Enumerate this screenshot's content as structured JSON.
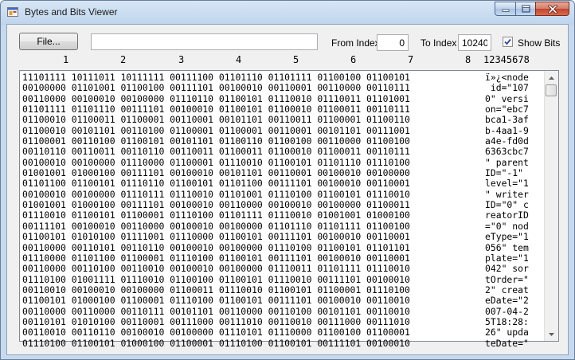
{
  "window": {
    "title": "Bytes and Bits Viewer"
  },
  "toolbar": {
    "file_label": "File...",
    "path_value": "",
    "from_label": "From Index",
    "from_value": "0",
    "to_label": "To Index",
    "to_value": "10240",
    "showbits_label": "Show Bits",
    "showbits_checked": true
  },
  "column_headers": [
    "1",
    "2",
    "3",
    "4",
    "5",
    "6",
    "7",
    "8"
  ],
  "ascii_header": "12345678",
  "rows": [
    [
      "11101111",
      "10111011",
      "10111111",
      "00111100",
      "01101110",
      "01101111",
      "01100100",
      "01100101"
    ],
    [
      "00100000",
      "01101001",
      "01100100",
      "00111101",
      "00100010",
      "00110001",
      "00110000",
      "00110111"
    ],
    [
      "00110000",
      "00100010",
      "00100000",
      "01110110",
      "01100101",
      "01110010",
      "01110011",
      "01101001"
    ],
    [
      "01101111",
      "01101110",
      "00111101",
      "00100010",
      "01100101",
      "01100010",
      "01100011",
      "00110111"
    ],
    [
      "01100010",
      "01100011",
      "01100001",
      "00110001",
      "00101101",
      "00110011",
      "01100001",
      "01100110"
    ],
    [
      "01100010",
      "00101101",
      "00110100",
      "01100001",
      "01100001",
      "00110001",
      "00101101",
      "00111001"
    ],
    [
      "01100001",
      "00110100",
      "01100101",
      "00101101",
      "01100110",
      "01100100",
      "00110000",
      "01100100"
    ],
    [
      "00110110",
      "00110011",
      "00110110",
      "00110011",
      "01100011",
      "01100010",
      "01100011",
      "00110111"
    ],
    [
      "00100010",
      "00100000",
      "01110000",
      "01100001",
      "01110010",
      "01100101",
      "01101110",
      "01110100"
    ],
    [
      "01001001",
      "01000100",
      "00111101",
      "00100010",
      "00101101",
      "00110001",
      "00100010",
      "00100000"
    ],
    [
      "01101100",
      "01100101",
      "01110110",
      "01100101",
      "01101100",
      "00111101",
      "00100010",
      "00110001"
    ],
    [
      "00100010",
      "00100000",
      "01110111",
      "01110010",
      "01101001",
      "01110100",
      "01100101",
      "01110010"
    ],
    [
      "01001001",
      "01000100",
      "00111101",
      "00100010",
      "00110000",
      "00100010",
      "00100000",
      "01100011"
    ],
    [
      "01110010",
      "01100101",
      "01100001",
      "01110100",
      "01101111",
      "01110010",
      "01001001",
      "01000100"
    ],
    [
      "00111101",
      "00100010",
      "00110000",
      "00100010",
      "00100000",
      "01101110",
      "01101111",
      "01100100"
    ],
    [
      "01100101",
      "01010100",
      "01111001",
      "01110000",
      "01100101",
      "00111101",
      "00100010",
      "00110001"
    ],
    [
      "00110000",
      "00110101",
      "00110110",
      "00100010",
      "00100000",
      "01110100",
      "01100101",
      "01101101"
    ],
    [
      "01110000",
      "01101100",
      "01100001",
      "01110100",
      "01100101",
      "00111101",
      "00100010",
      "00110001"
    ],
    [
      "00110000",
      "00110100",
      "00110010",
      "00100010",
      "00100000",
      "01110011",
      "01101111",
      "01110010"
    ],
    [
      "01110100",
      "01001111",
      "01110010",
      "01100100",
      "01100101",
      "01110010",
      "00111101",
      "00100010"
    ],
    [
      "00110010",
      "00100010",
      "00100000",
      "01100011",
      "01110010",
      "01100101",
      "01100001",
      "01110100"
    ],
    [
      "01100101",
      "01000100",
      "01100001",
      "01110100",
      "01100101",
      "00111101",
      "00100010",
      "00110010"
    ],
    [
      "00110000",
      "00110000",
      "00110111",
      "00101101",
      "00110000",
      "00110100",
      "00101101",
      "00110010"
    ],
    [
      "00110101",
      "01010100",
      "00110001",
      "00111000",
      "00111010",
      "00110010",
      "00111000",
      "00111010"
    ],
    [
      "00110010",
      "00110110",
      "00100010",
      "00100000",
      "01110101",
      "01110000",
      "01100100",
      "01100001"
    ],
    [
      "01110100",
      "01100101",
      "01000100",
      "01100001",
      "01110100",
      "01100101",
      "00111101",
      "00100010"
    ]
  ],
  "ascii_rows": [
    "ï»¿<node",
    " id=\"107",
    "0\" versi",
    "on=\"ebc7",
    "bca1-3af",
    "b-4aa1-9",
    "a4e-fd0d",
    "6363cbc7",
    "\" parent",
    "ID=\"-1\" ",
    "level=\"1",
    "\" writer",
    "ID=\"0\" c",
    "reatorID",
    "=\"0\" nod",
    "eType=\"1",
    "056\" tem",
    "plate=\"1",
    "042\" sor",
    "tOrder=\"",
    "2\" creat",
    "eDate=\"2",
    "007-04-2",
    "5T18:28:",
    "26\" upda",
    "teDate=\""
  ]
}
